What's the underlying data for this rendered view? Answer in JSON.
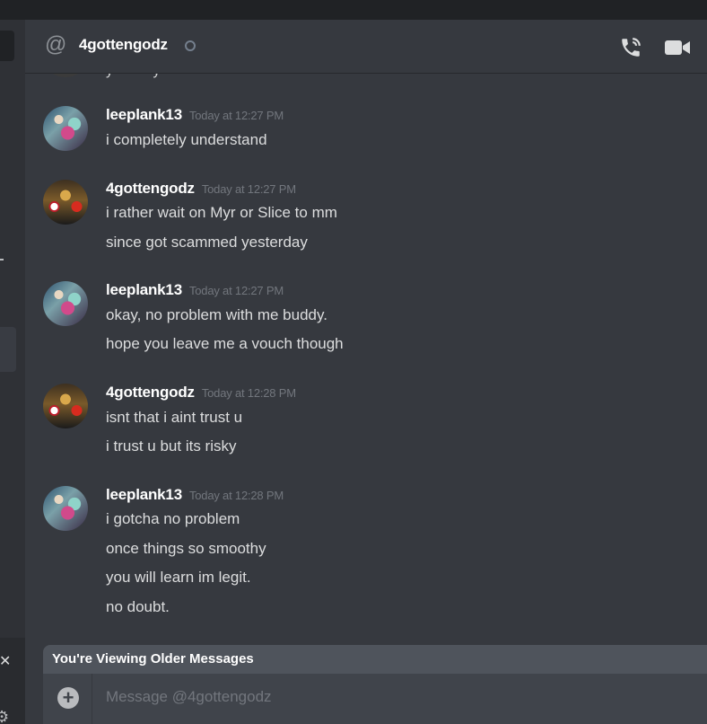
{
  "header": {
    "channel_name": "4gottengodz",
    "at_icon": "at-sign-icon",
    "call_icon": "phone-call-icon",
    "video_icon": "video-camera-icon"
  },
  "messages": [
    {
      "author": "leeplank13",
      "timestamp": "Today at 12:27 PM",
      "lines": [
        "i completely understand"
      ]
    },
    {
      "author": "4gottengodz",
      "timestamp": "Today at 12:27 PM",
      "lines": [
        "i rather wait on Myr or Slice to mm",
        "since got scammed yesterday"
      ]
    },
    {
      "author": "leeplank13",
      "timestamp": "Today at 12:27 PM",
      "lines": [
        "okay, no problem with me buddy.",
        "hope you leave me a vouch though"
      ]
    },
    {
      "author": "4gottengodz",
      "timestamp": "Today at 12:28 PM",
      "lines": [
        "isnt that i aint trust u",
        "i trust u but its risky"
      ]
    },
    {
      "author": "leeplank13",
      "timestamp": "Today at 12:28 PM",
      "lines": [
        "i gotcha no problem",
        "once things so smoothy",
        "you will learn im legit.",
        "no doubt."
      ]
    }
  ],
  "banner": {
    "text": "You're Viewing Older Messages"
  },
  "composer": {
    "placeholder": "Message @4gottengodz"
  },
  "colors": {
    "background": "#36393f",
    "sidebar": "#2f3136",
    "text": "#dcddde",
    "muted": "#72767d"
  }
}
